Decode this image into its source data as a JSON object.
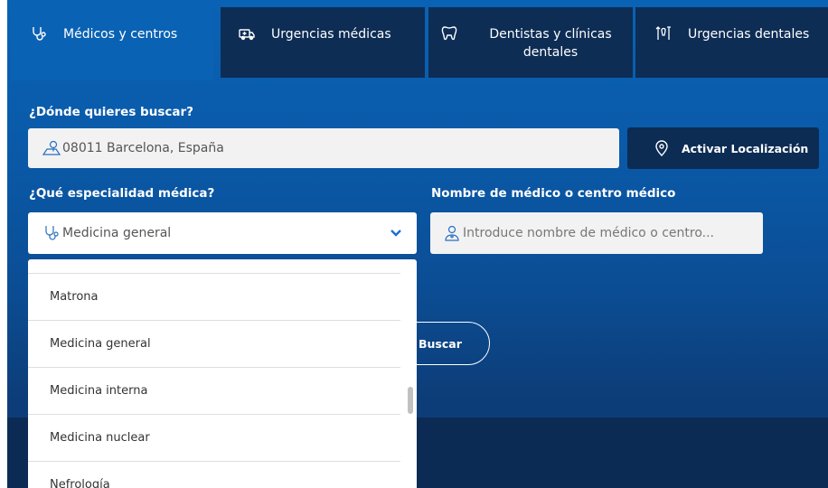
{
  "tabs": [
    {
      "label": "Médicos y centros",
      "icon": "stethoscope-icon",
      "active": true
    },
    {
      "label": "Urgencias médicas",
      "icon": "ambulance-icon",
      "active": false
    },
    {
      "label": "Dentistas y clínicas dentales",
      "icon": "tooth-icon",
      "active": false
    },
    {
      "label": "Urgencias dentales",
      "icon": "dental-tools-icon",
      "active": false
    }
  ],
  "location": {
    "label": "¿Dónde quieres buscar?",
    "value": "08011 Barcelona, España",
    "locate_button": "Activar Localización"
  },
  "specialty": {
    "label": "¿Qué especialidad médica?",
    "selected": "Medicina general",
    "options": [
      "Matrona",
      "Medicina general",
      "Medicina interna",
      "Medicina nuclear",
      "Nefrología"
    ]
  },
  "doctor": {
    "label": "Nombre de médico o centro médico",
    "placeholder": "Introduce nombre de médico o centro..."
  },
  "search_button": "Buscar",
  "colors": {
    "primary": "#0a62b4",
    "dark": "#0d2d55",
    "input_bg": "#f2f2f2"
  }
}
